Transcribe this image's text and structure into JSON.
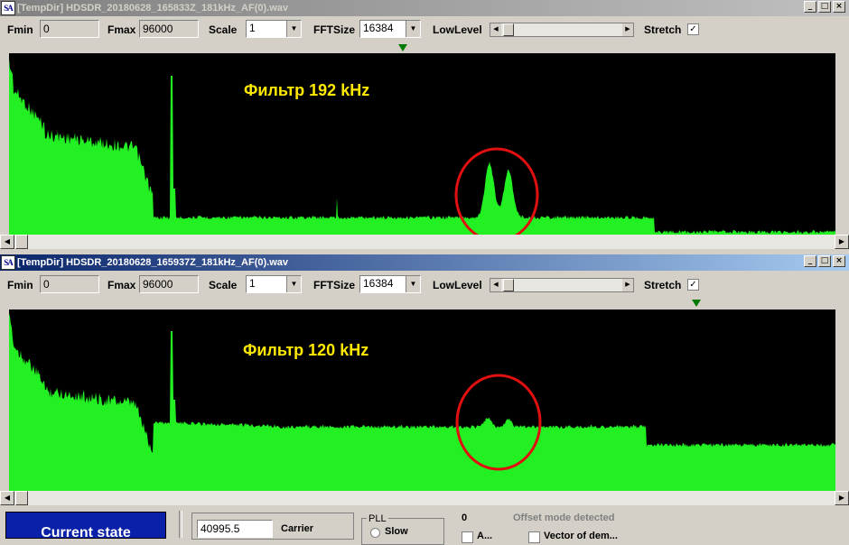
{
  "windows": [
    {
      "title": "[TempDir] HDSDR_20180628_165833Z_181kHz_AF(0).wav",
      "fmin_label": "Fmin",
      "fmin_value": "0",
      "fmax_label": "Fmax",
      "fmax_value": "96000",
      "scale_label": "Scale",
      "scale_value": "1",
      "fftsize_label": "FFTSize",
      "fftsize_value": "16384",
      "lowlevel_label": "LowLevel",
      "stretch_label": "Stretch",
      "stretch_checked": "✓",
      "annotation": "Фильтр 192 kHz"
    },
    {
      "title": "[TempDir] HDSDR_20180628_165937Z_181kHz_AF(0).wav",
      "fmin_label": "Fmin",
      "fmin_value": "0",
      "fmax_label": "Fmax",
      "fmax_value": "96000",
      "scale_label": "Scale",
      "scale_value": "1",
      "fftsize_label": "FFTSize",
      "fftsize_value": "16384",
      "lowlevel_label": "LowLevel",
      "stretch_label": "Stretch",
      "stretch_checked": "✓",
      "annotation": "Фильтр 120 kHz"
    }
  ],
  "window_buttons": {
    "minimize": "_",
    "maximize": "□",
    "close": "×"
  },
  "bottom": {
    "current_state_button": "Current state",
    "carrier_value": "40995.5",
    "carrier_label": "Carrier",
    "pll_group_label": "PLL",
    "pll_option": "Slow",
    "count_value": "0",
    "offset_status": "Offset mode detected",
    "checkbox_a_label": "A...",
    "checkbox_vector_label": "Vector of dem..."
  },
  "colors": {
    "spectrum_fill": "#22f022",
    "annotation_text": "#ffea00",
    "highlight_circle": "#e01010",
    "spectrum_bg": "#000000",
    "active_title": "#0a246a"
  }
}
